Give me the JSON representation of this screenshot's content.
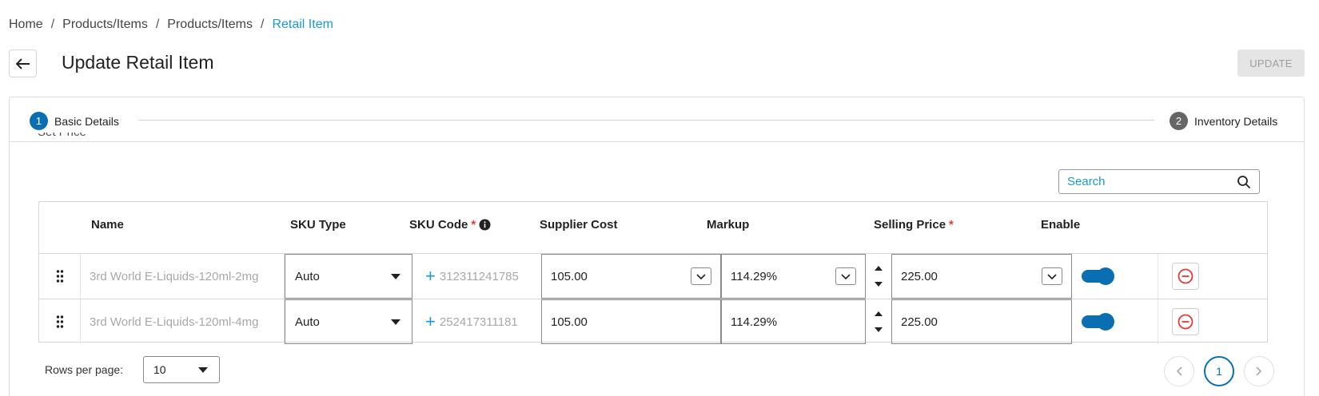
{
  "breadcrumb": [
    {
      "label": "Home"
    },
    {
      "label": "Products/Items"
    },
    {
      "label": "Products/Items"
    },
    {
      "label": "Retail Item"
    }
  ],
  "breadcrumb_separator": "/",
  "header": {
    "title": "Update Retail Item",
    "update_label": "UPDATE"
  },
  "stepper": [
    {
      "number": "1",
      "label": "Basic Details"
    },
    {
      "number": "2",
      "label": "Inventory Details"
    }
  ],
  "section_partial_label": "Set Price",
  "search": {
    "placeholder": "Search",
    "value": ""
  },
  "table": {
    "columns": {
      "name": "Name",
      "sku_type": "SKU Type",
      "sku_code": "SKU Code",
      "supplier_cost": "Supplier Cost",
      "markup": "Markup",
      "selling_price": "Selling Price",
      "enable": "Enable"
    },
    "required_mark": "*",
    "rows": [
      {
        "name": "3rd World E-Liquids-120ml-2mg",
        "sku_type": "Auto",
        "sku_code": "312311241785",
        "supplier_cost": "105.00",
        "markup": "114.29%",
        "selling_price": "225.00",
        "enabled": true
      },
      {
        "name": "3rd World E-Liquids-120ml-4mg",
        "sku_type": "Auto",
        "sku_code": "252417311181",
        "supplier_cost": "105.00",
        "markup": "114.29%",
        "selling_price": "225.00",
        "enabled": true
      }
    ]
  },
  "pagination": {
    "rows_per_page_label": "Rows per page:",
    "rows_per_page_value": "10",
    "current_page": "1"
  },
  "colors": {
    "accent": "#1b98d8",
    "primary": "#0a6fb2",
    "danger": "#e53935",
    "disabled_bg": "#e5e5e5"
  }
}
